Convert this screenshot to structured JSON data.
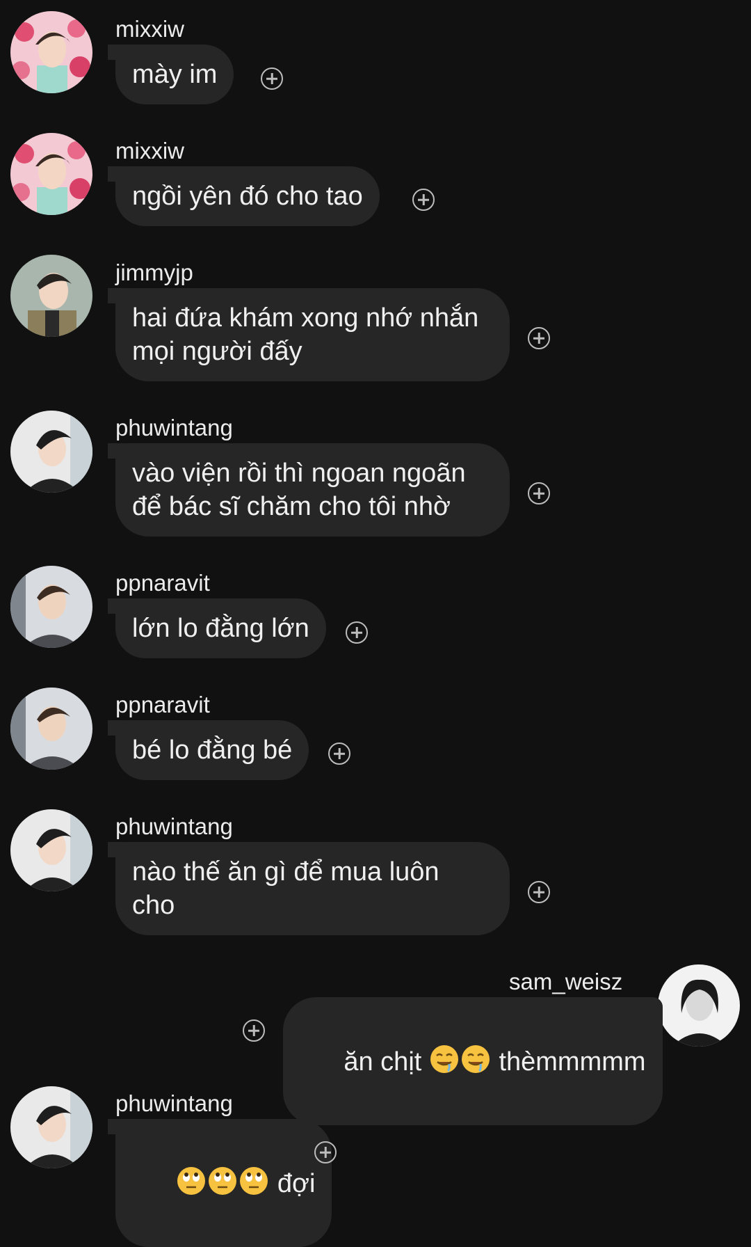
{
  "messages": [
    {
      "user": "mixxiw",
      "text": "mày im",
      "side": "left",
      "avatar": "pink-flower-avatar"
    },
    {
      "user": "mixxiw",
      "text": "ngồi yên đó cho tao",
      "side": "left",
      "avatar": "pink-flower-avatar"
    },
    {
      "user": "jimmyjp",
      "text": "hai đứa khám xong nhớ nhắn\nmọi người đấy",
      "side": "left",
      "avatar": "jacket-avatar"
    },
    {
      "user": "phuwintang",
      "text": "vào viện rồi thì ngoan ngoãn\nđể bác sĩ chăm cho tôi nhờ",
      "side": "left",
      "avatar": "dark-hair-avatar"
    },
    {
      "user": "ppnaravit",
      "text": "lớn lo đằng lớn",
      "side": "left",
      "avatar": "grey-shirt-avatar"
    },
    {
      "user": "ppnaravit",
      "text": "bé lo đằng bé",
      "side": "left",
      "avatar": "grey-shirt-avatar"
    },
    {
      "user": "phuwintang",
      "text": "nào thế ăn gì để mua luôn\ncho",
      "side": "left",
      "avatar": "dark-hair-avatar"
    },
    {
      "user": "sam_weisz",
      "text_before": "ăn chịt ",
      "text_after": " thèmmmmm",
      "emojis": [
        "drooling-face-emoji",
        "drooling-face-emoji"
      ],
      "side": "right",
      "avatar": "bw-girl-avatar"
    },
    {
      "user": "phuwintang",
      "text_after": " đợi",
      "emojis": [
        "eye-roll-emoji",
        "eye-roll-emoji",
        "eye-roll-emoji"
      ],
      "side": "left",
      "avatar": "dark-hair-avatar"
    }
  ],
  "icons": {
    "add_reaction": "add-reaction-icon"
  },
  "colors": {
    "background": "#111111",
    "bubble": "#262626",
    "text": "#f0f0f0",
    "icon": "#bdbdbd"
  }
}
